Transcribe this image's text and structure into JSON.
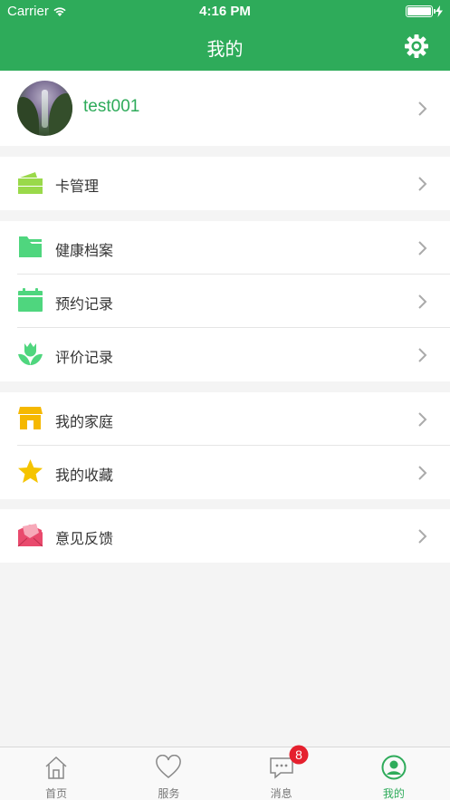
{
  "status_bar": {
    "carrier": "Carrier",
    "time": "4:16 PM"
  },
  "nav": {
    "title": "我的"
  },
  "profile": {
    "username": "test001"
  },
  "groups": [
    {
      "items": [
        {
          "label": "卡管理",
          "icon": "card-icon"
        }
      ]
    },
    {
      "items": [
        {
          "label": "健康档案",
          "icon": "folder-icon"
        },
        {
          "label": "预约记录",
          "icon": "calendar-icon"
        },
        {
          "label": "评价记录",
          "icon": "tulip-icon"
        }
      ]
    },
    {
      "items": [
        {
          "label": "我的家庭",
          "icon": "house-icon"
        },
        {
          "label": "我的收藏",
          "icon": "star-icon"
        }
      ]
    },
    {
      "items": [
        {
          "label": "意见反馈",
          "icon": "envelope-icon"
        }
      ]
    }
  ],
  "tabbar": {
    "tabs": [
      {
        "label": "首页",
        "icon": "home-icon"
      },
      {
        "label": "服务",
        "icon": "heart-icon"
      },
      {
        "label": "消息",
        "icon": "chat-icon",
        "badge": "8"
      },
      {
        "label": "我的",
        "icon": "user-icon",
        "active": true
      }
    ]
  },
  "colors": {
    "primary": "#2eab5a",
    "badge": "#e5202e",
    "card": "#9ad94a",
    "folder": "#4fd67e",
    "house": "#f5b800",
    "star": "#f5c400",
    "envelope": "#e94a6d"
  }
}
